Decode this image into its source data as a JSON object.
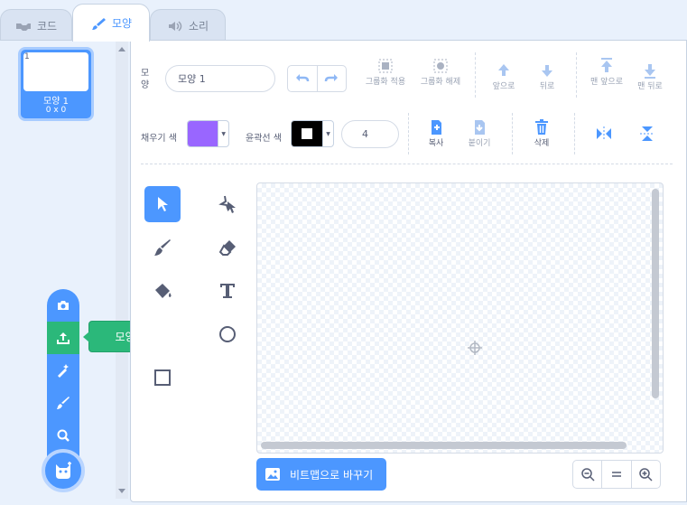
{
  "tabs": [
    {
      "label": "코드"
    },
    {
      "label": "모양"
    },
    {
      "label": "소리"
    }
  ],
  "costume": {
    "index": "1",
    "name": "모양 1",
    "size": "0 x 0"
  },
  "add_menu": {
    "tooltip": "모양 업로드하기",
    "items": [
      "camera-icon",
      "upload-icon",
      "surprise-icon",
      "paint-icon",
      "search-icon"
    ],
    "main_icon": "cat-icon"
  },
  "toolbar": {
    "costume_label": "모양",
    "costume_name": "모양 1",
    "group": "그룹화 적용",
    "ungroup": "그룹화 해제",
    "forward": "앞으로",
    "backward": "뒤로",
    "front": "맨 앞으로",
    "back": "맨 뒤로",
    "fill_label": "채우기 색",
    "outline_label": "윤곽선 색",
    "outline_width": "4",
    "copy": "복사",
    "paste": "붙이기",
    "delete": "삭제"
  },
  "colors": {
    "fill": "#9966ff",
    "outline": "#000000",
    "accent": "#4c97ff",
    "tooltip": "#2bb87a"
  },
  "canvas": {
    "convert_label": "비트맵으로 바꾸기"
  }
}
